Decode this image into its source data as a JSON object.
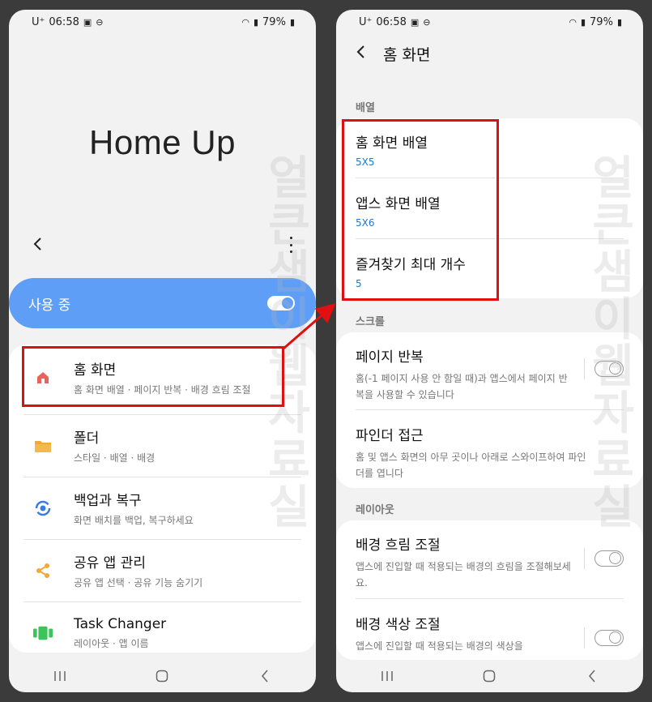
{
  "status_bar": {
    "carrier": "U⁺",
    "time": "06:58",
    "battery": "79%"
  },
  "left": {
    "app_title": "Home Up",
    "master_switch_label": "사용 중",
    "master_switch_on": true,
    "items": [
      {
        "title": "홈 화면",
        "subtitle": "홈 화면 배열 · 페이지 반복 · 배경 흐림 조절",
        "icon": "home-icon",
        "icon_color": "#e8645a"
      },
      {
        "title": "폴더",
        "subtitle": "스타일 · 배열 · 배경",
        "icon": "folder-icon",
        "icon_color": "#f2a93b"
      },
      {
        "title": "백업과 복구",
        "subtitle": "화면 배치를 백업, 복구하세요",
        "icon": "backup-restore-icon",
        "icon_color": "#3a7be0"
      },
      {
        "title": "공유 앱 관리",
        "subtitle": "공유 앱 선택 · 공유 기능 숨기기",
        "icon": "share-icon",
        "icon_color": "#f2a93b"
      },
      {
        "title": "Task Changer",
        "subtitle": "레이아웃 · 앱 이름",
        "icon": "task-changer-icon",
        "icon_color": "#3bc45a"
      }
    ]
  },
  "right": {
    "header_title": "홈 화면",
    "sections": {
      "layout_label": "배열",
      "scroll_label": "스크롤",
      "layout2_label": "레이아웃"
    },
    "layout_rows": [
      {
        "title": "홈 화면 배열",
        "value": "5X5"
      },
      {
        "title": "앱스 화면 배열",
        "value": "5X6"
      },
      {
        "title": "즐겨찾기 최대 개수",
        "value": "5"
      }
    ],
    "scroll_rows": [
      {
        "title": "페이지 반복",
        "desc": "홈(-1 페이지 사용 안 함일 때)과 앱스에서 페이지 반복을 사용할 수 있습니다",
        "toggle": false
      },
      {
        "title": "파인더 접근",
        "desc": "홈 및 앱스 화면의 아무 곳이나 아래로 스와이프하여 파인더를 엽니다"
      }
    ],
    "layout2_rows": [
      {
        "title": "배경 흐림 조절",
        "desc": "앱스에 진입할 때 적용되는 배경의 흐림을 조절해보세요.",
        "toggle": false
      },
      {
        "title": "배경 색상 조절",
        "desc": "앱스에 진입할 때 적용되는 배경의 색상을",
        "toggle": false
      }
    ]
  },
  "colors": {
    "accent": "#5f9ef7",
    "highlight": "#e01010",
    "value_blue": "#1d78c9"
  }
}
